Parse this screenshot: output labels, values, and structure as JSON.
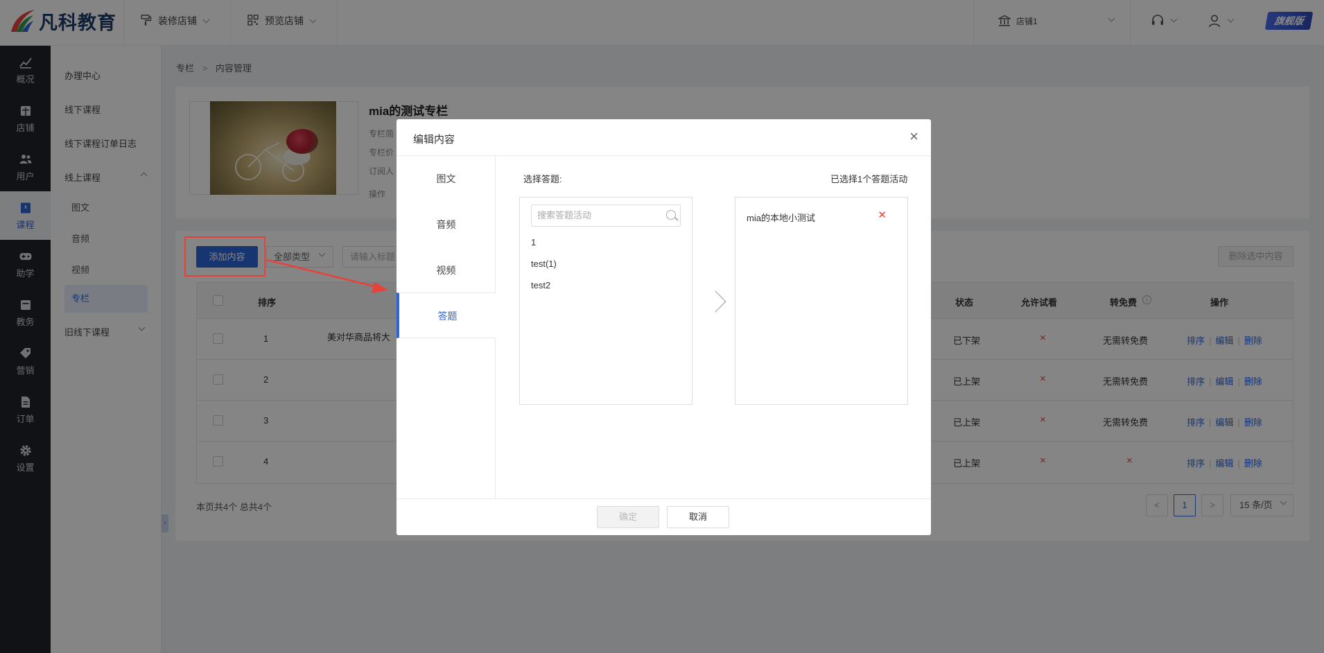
{
  "header": {
    "brand": "凡科教育",
    "menus": [
      {
        "label": "装修店铺",
        "icon": "paint-roller-icon"
      },
      {
        "label": "预览店铺",
        "icon": "qr-code-icon"
      }
    ],
    "store": "店铺1",
    "edition_badge": "旗舰版"
  },
  "main_nav": [
    {
      "label": "概况",
      "icon": "chart-icon"
    },
    {
      "label": "店铺",
      "icon": "store-icon"
    },
    {
      "label": "用户",
      "icon": "users-icon"
    },
    {
      "label": "课程",
      "icon": "book-icon"
    },
    {
      "label": "助学",
      "icon": "gamepad-icon"
    },
    {
      "label": "教务",
      "icon": "calendar-icon"
    },
    {
      "label": "营销",
      "icon": "tag-icon"
    },
    {
      "label": "订单",
      "icon": "document-icon"
    },
    {
      "label": "设置",
      "icon": "gear-icon"
    }
  ],
  "sub_nav": {
    "items": [
      "办理中心",
      "线下课程",
      "线下课程订单日志",
      "线上课程"
    ],
    "online_children": [
      "图文",
      "音频",
      "视频",
      "专栏"
    ],
    "legacy": "旧线下课程"
  },
  "breadcrumb": [
    "专栏",
    "内容管理"
  ],
  "column": {
    "title": "mia的测试专栏",
    "meta": [
      "专栏简",
      "专栏价",
      "订阅人",
      "操作"
    ]
  },
  "toolbar": {
    "add_button": "添加内容",
    "type_filter": "全部类型",
    "title_placeholder": "请输入标题",
    "delete_selected": "删除选中内容"
  },
  "table": {
    "headers": {
      "sort": "排序",
      "status": "状态",
      "trial": "允许试看",
      "free": "转免费",
      "ops": "操作"
    },
    "rows": [
      {
        "sort": "1",
        "title": "美对华商品将大",
        "status": "已下架",
        "free": "无需转免费"
      },
      {
        "sort": "2",
        "title": "",
        "status": "已上架",
        "free": "无需转免费"
      },
      {
        "sort": "3",
        "title": "",
        "status": "已上架",
        "free": "无需转免费"
      },
      {
        "sort": "4",
        "title": "",
        "status": "已上架",
        "free": ""
      }
    ],
    "op_labels": {
      "sort": "排序",
      "edit": "编辑",
      "delete": "删除"
    },
    "x_glyph": "×"
  },
  "pagination": {
    "summary": "本页共4个 总共4个",
    "prev": "<",
    "current": "1",
    "next": ">",
    "page_size": "15 条/页"
  },
  "modal": {
    "title": "编辑内容",
    "close": "×",
    "tabs": [
      "图文",
      "音频",
      "视频",
      "答题"
    ],
    "select_label": "选择答题:",
    "selected_count": "已选择1个答题活动",
    "search_placeholder": "搜索答题活动",
    "options": [
      "1",
      "test(1)",
      "test2"
    ],
    "selected_items": [
      "mia的本地小测试"
    ],
    "confirm": "确定",
    "cancel": "取消"
  },
  "colors": {
    "accent": "#2c66d8",
    "annotation": "#e8413a",
    "dark_nav": "#1f2329"
  }
}
